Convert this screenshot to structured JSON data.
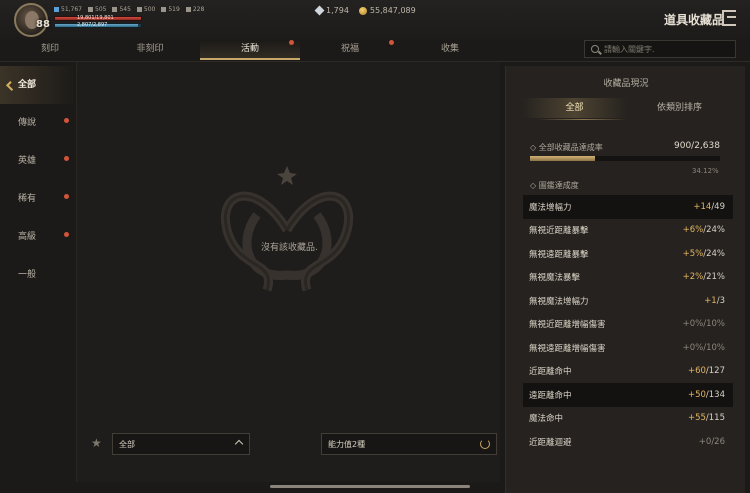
{
  "player": {
    "level": "88",
    "stats": [
      "51,767",
      "505",
      "545",
      "500",
      "519",
      "228"
    ],
    "hp_text": "19,801/19,801",
    "mp_text": "2,807/2,897"
  },
  "currency": {
    "diamonds": "1,794",
    "gold": "55,847,089"
  },
  "header": {
    "title": "道具收藏品"
  },
  "tabs": [
    {
      "label": "刻印",
      "active": false,
      "dot": false
    },
    {
      "label": "非刻印",
      "active": false,
      "dot": false
    },
    {
      "label": "活動",
      "active": true,
      "dot": true
    },
    {
      "label": "祝福",
      "active": false,
      "dot": true
    },
    {
      "label": "收集",
      "active": false,
      "dot": false
    }
  ],
  "search": {
    "placeholder": "請輸入關鍵字."
  },
  "sidebar": {
    "items": [
      {
        "label": "全部",
        "active": true,
        "dot": false
      },
      {
        "label": "傳說",
        "active": false,
        "dot": true
      },
      {
        "label": "英雄",
        "active": false,
        "dot": true
      },
      {
        "label": "稀有",
        "active": false,
        "dot": true
      },
      {
        "label": "高級",
        "active": false,
        "dot": true
      },
      {
        "label": "一般",
        "active": false,
        "dot": false
      }
    ]
  },
  "main": {
    "empty_text": "沒有該收藏品.",
    "filter_label": "全部",
    "ability_label": "能力值2種"
  },
  "panel": {
    "title": "收藏品現況",
    "seg_all": "全部",
    "seg_sort": "依類別排序",
    "rate_label": "全部收藏品達成率",
    "rate_value": "900/2,638",
    "rate_fraction": 0.3412,
    "rate_pct": "34.12%",
    "codex_label": "圖鑑達成度",
    "rows": [
      {
        "name": "魔法增幅力",
        "gain": "+14",
        "rest": "/49",
        "hl": true,
        "active": true
      },
      {
        "name": "無視近距離暴擊",
        "gain": "+6%",
        "rest": "/24%",
        "hl": false,
        "active": true
      },
      {
        "name": "無視遠距離暴擊",
        "gain": "+5%",
        "rest": "/24%",
        "hl": false,
        "active": true
      },
      {
        "name": "無視魔法暴擊",
        "gain": "+2%",
        "rest": "/21%",
        "hl": false,
        "active": true
      },
      {
        "name": "無視魔法增幅力",
        "gain": "+1",
        "rest": "/3",
        "hl": false,
        "active": true
      },
      {
        "name": "無視近距離增幅傷害",
        "gain": "+0%",
        "rest": "/10%",
        "hl": false,
        "active": false
      },
      {
        "name": "無視遠距離增幅傷害",
        "gain": "+0%",
        "rest": "/10%",
        "hl": false,
        "active": false
      },
      {
        "name": "近距離命中",
        "gain": "+60",
        "rest": "/127",
        "hl": false,
        "active": true
      },
      {
        "name": "遠距離命中",
        "gain": "+50",
        "rest": "/134",
        "hl": true,
        "active": true
      },
      {
        "name": "魔法命中",
        "gain": "+55",
        "rest": "/115",
        "hl": false,
        "active": true
      },
      {
        "name": "近距離迴避",
        "gain": "+0",
        "rest": "/26",
        "hl": false,
        "active": false
      }
    ]
  },
  "colors": {
    "accent": "#c8a86a",
    "alert_dot": "#d2553a",
    "gain": "#e3b562"
  }
}
